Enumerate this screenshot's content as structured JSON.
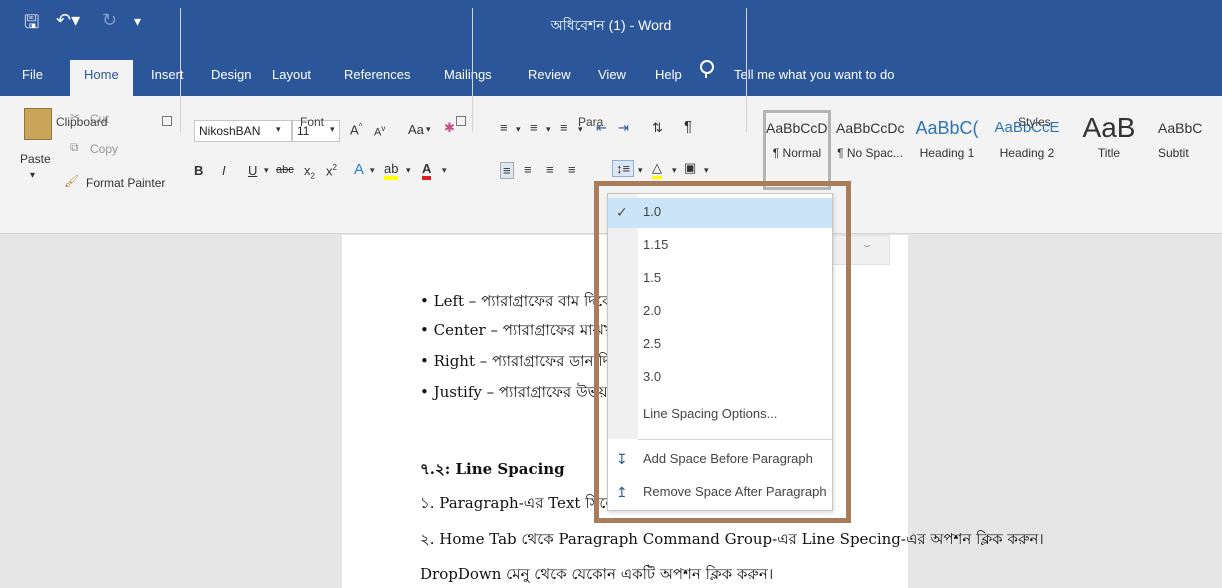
{
  "window": {
    "title": "অধিবেশন (1) - Word"
  },
  "tabs": [
    {
      "label": "File"
    },
    {
      "label": "Home"
    },
    {
      "label": "Insert"
    },
    {
      "label": "Design"
    },
    {
      "label": "Layout"
    },
    {
      "label": "References"
    },
    {
      "label": "Mailings"
    },
    {
      "label": "Review"
    },
    {
      "label": "View"
    },
    {
      "label": "Help"
    }
  ],
  "tell_me": "Tell me what you want to do",
  "clipboard": {
    "paste": "Paste",
    "cut": "Cut",
    "copy": "Copy",
    "format_painter": "Format Painter",
    "label": "Clipboard"
  },
  "font": {
    "name": "NikoshBAN",
    "size": "11",
    "label": "Font",
    "case_label": "Aa"
  },
  "paragraph": {
    "label": "Para"
  },
  "styles": {
    "label": "Styles",
    "items": [
      {
        "preview": "AaBbCcDc",
        "name": "¶ Normal"
      },
      {
        "preview": "AaBbCcDc",
        "name": "¶ No Spac..."
      },
      {
        "preview": "AaBbC(",
        "name": "Heading 1"
      },
      {
        "preview": "AaBbCcE",
        "name": "Heading 2"
      },
      {
        "preview": "AaB",
        "name": "Title"
      },
      {
        "preview": "AaBbC",
        "name": "Subtit"
      }
    ]
  },
  "document": {
    "lines": [
      "• Left – প্যারাগ্রাফের বাম দিকে স",
      "• Center – প্যারাগ্রাফের মাঝখান",
      "• Right – প্যারাগ্রাফের ডান দিকে",
      "• Justify – প্যারাগ্রাফের উভয় দিক",
      "৭.২: Line Spacing",
      "১. Paragraph-এর Text সিলেক্ট করুন।",
      "২. Home Tab থেকে Paragraph Command Group-এর Line Specing-এর অপশন ক্লিক করুন।",
      "DropDown মেনু থেকে যেকোন একটি অপশন ক্লিক করুন।"
    ]
  },
  "line_spacing_menu": {
    "options": [
      "1.0",
      "1.15",
      "1.5",
      "2.0",
      "2.5",
      "3.0"
    ],
    "selected": "1.0",
    "more_options": "Line Spacing Options...",
    "add_space_before": "Add Space Before Paragraph",
    "remove_space_after": "Remove Space After Paragraph"
  },
  "colors": {
    "brand": "#2b579a",
    "highlight_frame": "#a97c5b",
    "ribbon_bg": "#f3f3f3"
  }
}
